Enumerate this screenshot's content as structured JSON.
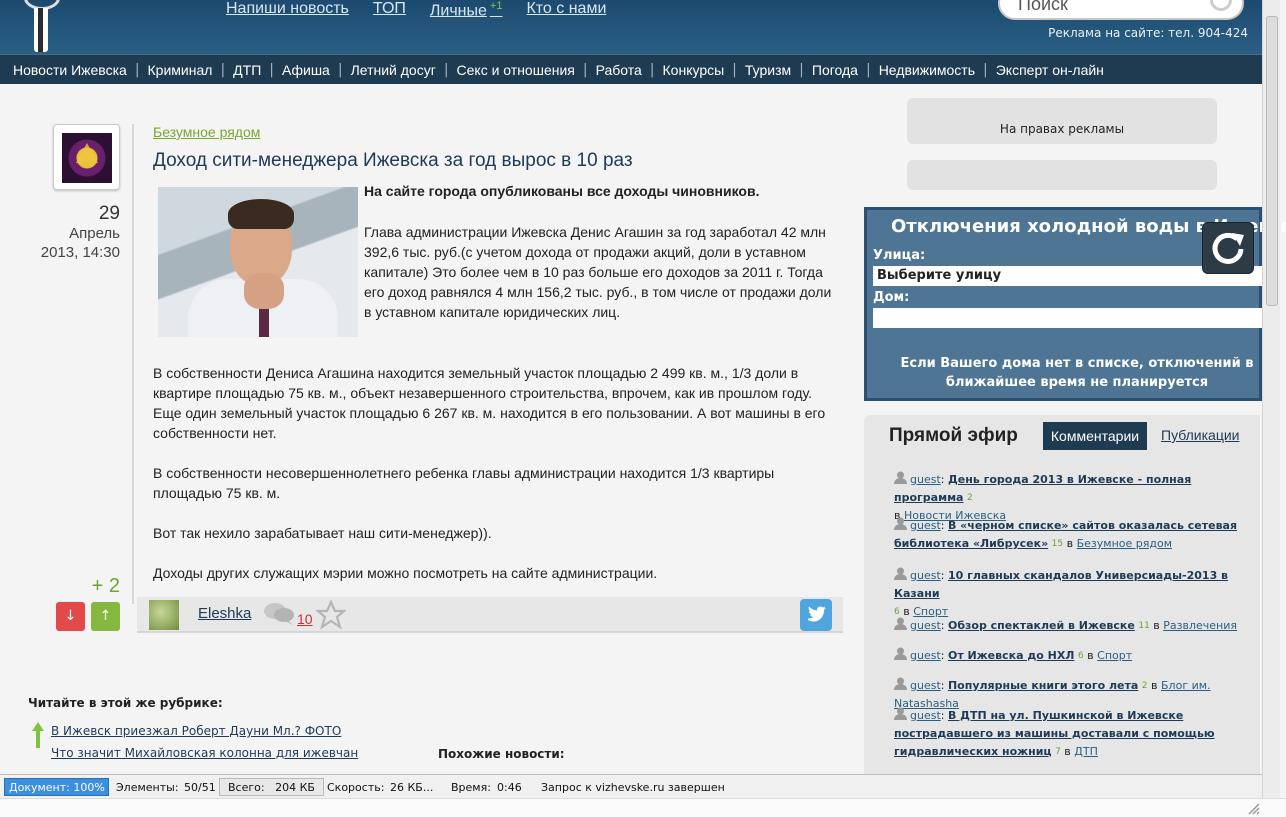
{
  "header": {
    "top_links": [
      {
        "label": "Напиши новость"
      },
      {
        "label": "ТОП"
      },
      {
        "label": "Личные",
        "badge": "+1"
      },
      {
        "label": "Кто с нами"
      }
    ],
    "search_placeholder": "Поиск",
    "ad_phone": "Реклама на сайте: тел. 904-424"
  },
  "nav": [
    "Новости Ижевска",
    "Криминал",
    "ДТП",
    "Афиша",
    "Летний досуг",
    "Секс и отношения",
    "Работа",
    "Конкурсы",
    "Туризм",
    "Погода",
    "Недвижимость",
    "Эксперт он-лайн"
  ],
  "post": {
    "date_day": "29",
    "date_month": "Апрель",
    "date_time": "2013, 14:30",
    "rubric": "Безумное рядом",
    "title": "Доход сити-менеджера Ижевска за год вырос в 10 раз",
    "lead": "На сайте города опубликованы все доходы чиновников.",
    "paragraphs": [
      "Глава администрации Ижевска Денис Агашин за год заработал 42 млн 392,6 тыс. руб.(с учетом дохода от продажи акций, доли в уставном капитале) Это более чем в 10 раз больше его доходов за 2011 г. Тогда его доход равнялся 4 млн 156,2 тыс. руб., в том числе от продажи доли в уставном капитале юридических лиц.",
      "В собственности Дениса Агашина находится земельный участок площадью 2 499 кв. м., 1/3 доли в квартире площадью 75 кв. м., объект незавершенного строительства, впрочем, как ив прошлом году. Еще один земельный участок площадью 6 267 кв. м. находится в его пользовании. А вот машины в его собственности нет.",
      "В собственности несовершеннолетнего ребенка главы администрации находится 1/3 квартиры площадью 75 кв. м.",
      "Вот так нехило зарабатывает наш сити-менеджер)).",
      "Доходы других служащих мэрии можно посмотреть на сайте администрации."
    ],
    "score": "+ 2",
    "vote_down": "↓",
    "vote_up": "↑",
    "author": "Eleshka",
    "comments_count": "10"
  },
  "related": {
    "heading": "Читайте в этой же рубрике:",
    "items": [
      "В Ижевск приезжал Роберт Дауни Мл.? ФОТО",
      "Что значит Михайловская колонна для ижевчан"
    ],
    "similar_heading": "Похожие новости:"
  },
  "sidebar": {
    "ad_label": "На правах рекламы",
    "water": {
      "title": "Отключения холодной воды в Ижевске",
      "street_label": "Улица:",
      "street_value": "Выберите улицу",
      "house_label": "Дом:",
      "note": "Если Вашего дома нет в списке, отключений в ближайшее время не планируется"
    },
    "live": {
      "title": "Прямой эфир",
      "tab_comments": "Комментарии",
      "tab_publications": "Публикации",
      "items": [
        {
          "user": "guest",
          "title": "День города 2013 в Ижевске - полная программа",
          "count": "2",
          "category": "Новости Ижевска"
        },
        {
          "user": "guest",
          "title": "В «черном списке» сайтов оказалась сетевая библиотека «Либрусек»",
          "count": "15",
          "category": "Безумное рядом"
        },
        {
          "user": "guest",
          "title": "10 главных скандалов Универсиады-2013 в Казани",
          "count": "6",
          "category": "Спорт"
        },
        {
          "user": "guest",
          "title": "Обзор спектаклей в Ижевске",
          "count": "11",
          "category": "Развлечения"
        },
        {
          "user": "guest",
          "title": "От Ижевска до НХЛ",
          "count": "6",
          "category": "Спорт"
        },
        {
          "user": "guest",
          "title": "Популярные книги этого лета",
          "count": "2",
          "category": "Блог им. Natashasha"
        },
        {
          "user": "guest",
          "title": "В ДТП на ул. Пушкинской в Ижевске пострадавшего из машины доставали с помощью гидравлических ножниц",
          "count": "7",
          "category": "ДТП"
        }
      ],
      "in_word": "в"
    }
  },
  "statusbar": {
    "document": "Документ:   100%",
    "elements_label": "Элементы:",
    "elements_value": "50/51",
    "total_label": "Всего:",
    "total_value": "204 КБ",
    "speed_label": "Скорость:",
    "speed_value": "26 КБ...",
    "time_label": "Время:",
    "time_value": "0:46",
    "request": "Запрос к vizhevske.ru завершен"
  }
}
